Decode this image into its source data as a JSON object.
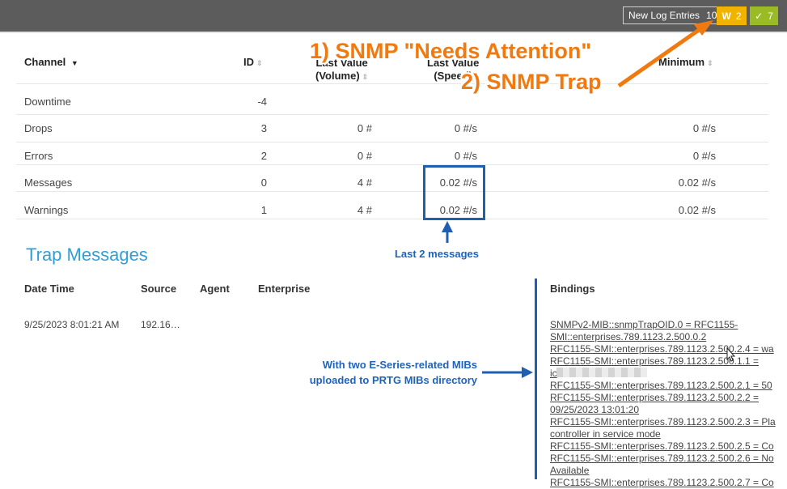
{
  "topbar": {
    "log_label": "New Log Entries",
    "log_count": "10",
    "warning_letter": "W",
    "warning_count": "2",
    "ok_count": "7",
    "colors": {
      "bar": "#5c5c5c",
      "warning": "#f0b400",
      "ok": "#9bbb25"
    }
  },
  "channels": {
    "headers": {
      "channel": "Channel",
      "id": "ID",
      "last_value_volume_1": "Last Value",
      "last_value_volume_2": "(Volume)",
      "last_value_speed_1": "Last Value",
      "last_value_speed_2": "(Speed)",
      "minimum": "Minimum"
    },
    "rows": [
      {
        "name": "Downtime",
        "id": "-4",
        "volume": "",
        "speed": "",
        "minimum": ""
      },
      {
        "name": "Drops",
        "id": "3",
        "volume": "0 #",
        "speed": "0 #/s",
        "minimum": "0 #/s"
      },
      {
        "name": "Errors",
        "id": "2",
        "volume": "0 #",
        "speed": "0 #/s",
        "minimum": "0 #/s"
      },
      {
        "name": "Messages",
        "id": "0",
        "volume": "4 #",
        "speed": "0.02 #/s",
        "minimum": "0.02 #/s"
      },
      {
        "name": "Warnings",
        "id": "1",
        "volume": "4 #",
        "speed": "0.02 #/s",
        "minimum": "0.02 #/s"
      }
    ]
  },
  "trap": {
    "title": "Trap Messages",
    "headers": {
      "datetime": "Date Time",
      "source": "Source",
      "agent": "Agent",
      "enterprise": "Enterprise",
      "bindings": "Bindings"
    },
    "row": {
      "datetime": "9/25/2023 8:01:21 AM",
      "source": "192.16…"
    },
    "bindings": [
      "SNMPv2-MIB::snmpTrapOID.0 = RFC1155-",
      "SMI::enterprises.789.1123.2.500.0.2",
      "RFC1155-SMI::enterprises.789.1123.2.500.2.4 = wa",
      "RFC1155-SMI::enterprises.789.1123.2.500.1.1 =",
      "ic",
      "RFC1155-SMI::enterprises.789.1123.2.500.2.1 = 50",
      "RFC1155-SMI::enterprises.789.1123.2.500.2.2 =",
      "09/25/2023 13:01:20",
      "RFC1155-SMI::enterprises.789.1123.2.500.2.3 = Pla",
      "controller in service mode",
      "RFC1155-SMI::enterprises.789.1123.2.500.2.5 = Co",
      "RFC1155-SMI::enterprises.789.1123.2.500.2.6 = No",
      "Available",
      "RFC1155-SMI::enterprises.789.1123.2.500.2.7 = Co"
    ]
  },
  "annotations": {
    "snmp_needs_attention": "1) SNMP \"Needs Attention\"",
    "snmp_trap": "2) SNMP Trap",
    "last_2_messages": "Last 2 messages",
    "mibs_line1": "With two E-Series-related MIBs",
    "mibs_line2": "uploaded to PRTG MIBs directory"
  }
}
